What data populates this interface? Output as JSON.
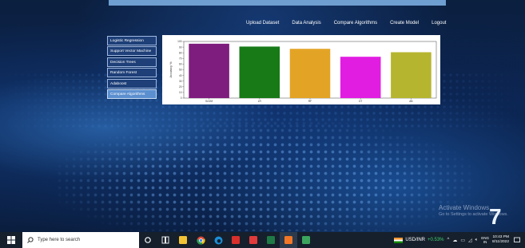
{
  "nav": {
    "links": [
      "Upload Dataset",
      "Data Analysis",
      "Compare Algorithms",
      "Create Model",
      "Logout"
    ]
  },
  "sidebar": {
    "items": [
      "Logistic Regression",
      "Support Vector Machine",
      "Decision Trees",
      "Random Forest",
      "Adaboost",
      "Compare Algorithms"
    ],
    "active": "Compare Algorithms"
  },
  "chart_data": {
    "type": "bar",
    "ylabel": "Accuracy %",
    "ylim": [
      0,
      100
    ],
    "yticks": [
      "0",
      "10",
      "20",
      "30",
      "40",
      "50",
      "60",
      "70",
      "80",
      "90",
      "100"
    ],
    "categories": [
      "SUVM",
      "LR",
      "RF",
      "DT",
      "AB"
    ],
    "values": [
      96,
      91,
      87,
      73,
      81
    ],
    "colors": [
      "#7e1d7e",
      "#177a17",
      "#e3a426",
      "#e21de2",
      "#b6b52f"
    ]
  },
  "watermark": {
    "title": "Activate Windows",
    "subtitle": "Go to Settings to activate Windows."
  },
  "cursor_glyph": "7",
  "taskbar": {
    "search_placeholder": "Type here to search",
    "pinned_icons": [
      "task-view-icon",
      "widgets-icon",
      "file-explorer-icon",
      "chrome-icon",
      "edge-icon",
      "red-app-icon",
      "video-app-icon",
      "excel-icon",
      "jupyter-icon",
      "code-icon"
    ],
    "stock_label": "USD/INR",
    "stock_change": "+0.53%",
    "lang_line1": "ENG",
    "lang_line2": "IN",
    "time": "10:43 PM",
    "date": "8/11/2022"
  }
}
